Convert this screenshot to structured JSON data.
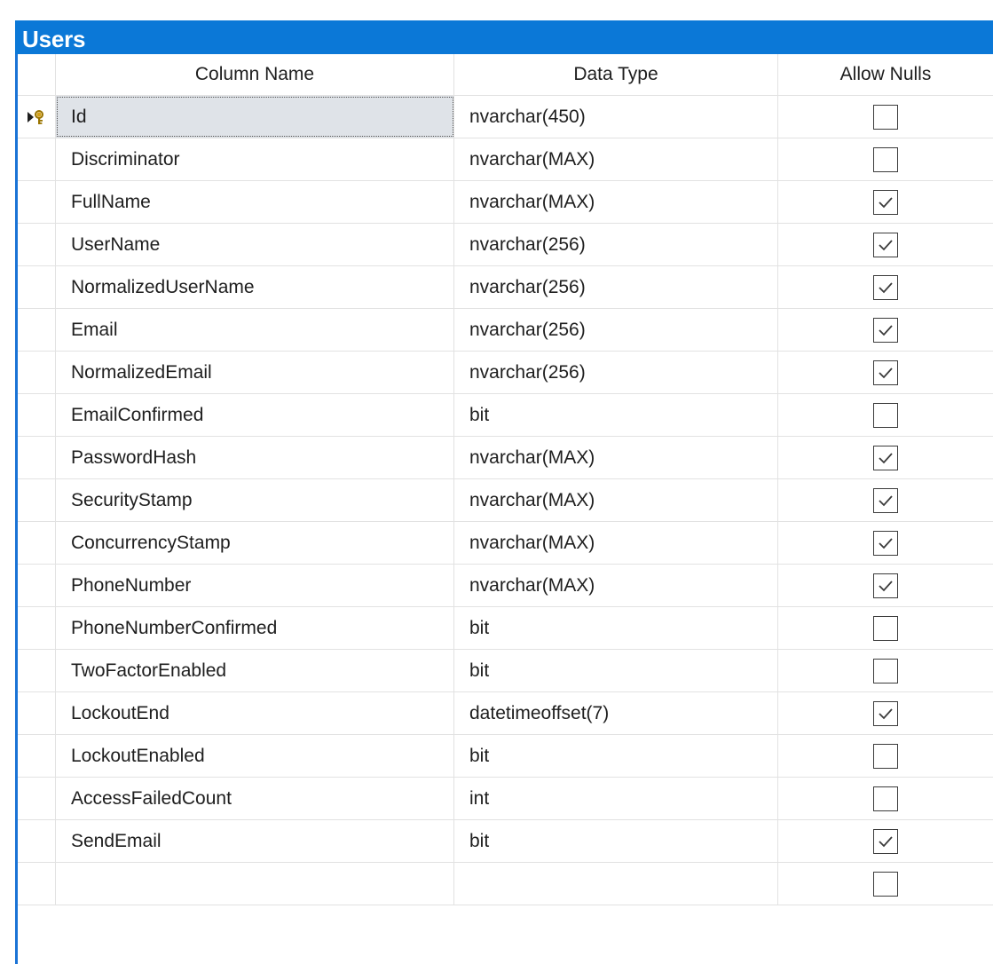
{
  "table": {
    "title": "Users",
    "columns": {
      "name": "Column Name",
      "type": "Data Type",
      "nulls": "Allow Nulls"
    },
    "rows": [
      {
        "name": "Id",
        "type": "nvarchar(450)",
        "allow_nulls": false,
        "primary_key": true,
        "current": true
      },
      {
        "name": "Discriminator",
        "type": "nvarchar(MAX)",
        "allow_nulls": false
      },
      {
        "name": "FullName",
        "type": "nvarchar(MAX)",
        "allow_nulls": true
      },
      {
        "name": "UserName",
        "type": "nvarchar(256)",
        "allow_nulls": true
      },
      {
        "name": "NormalizedUserName",
        "type": "nvarchar(256)",
        "allow_nulls": true
      },
      {
        "name": "Email",
        "type": "nvarchar(256)",
        "allow_nulls": true
      },
      {
        "name": "NormalizedEmail",
        "type": "nvarchar(256)",
        "allow_nulls": true
      },
      {
        "name": "EmailConfirmed",
        "type": "bit",
        "allow_nulls": false
      },
      {
        "name": "PasswordHash",
        "type": "nvarchar(MAX)",
        "allow_nulls": true
      },
      {
        "name": "SecurityStamp",
        "type": "nvarchar(MAX)",
        "allow_nulls": true
      },
      {
        "name": "ConcurrencyStamp",
        "type": "nvarchar(MAX)",
        "allow_nulls": true
      },
      {
        "name": "PhoneNumber",
        "type": "nvarchar(MAX)",
        "allow_nulls": true
      },
      {
        "name": "PhoneNumberConfirmed",
        "type": "bit",
        "allow_nulls": false
      },
      {
        "name": "TwoFactorEnabled",
        "type": "bit",
        "allow_nulls": false
      },
      {
        "name": "LockoutEnd",
        "type": "datetimeoffset(7)",
        "allow_nulls": true
      },
      {
        "name": "LockoutEnabled",
        "type": "bit",
        "allow_nulls": false
      },
      {
        "name": "AccessFailedCount",
        "type": "int",
        "allow_nulls": false
      },
      {
        "name": "SendEmail",
        "type": "bit",
        "allow_nulls": true
      },
      {
        "name": "",
        "type": "",
        "allow_nulls": false
      }
    ]
  },
  "icons": {
    "row_indicator": "current-row-primary-key-icon",
    "checked": "checkmark-icon"
  },
  "colors": {
    "title_bar": "#0b78d7",
    "title_text": "#ffffff",
    "selected_cell": "#dfe3e8",
    "grid_line": "#e2e2e2",
    "key_gold": "#d4a017"
  }
}
